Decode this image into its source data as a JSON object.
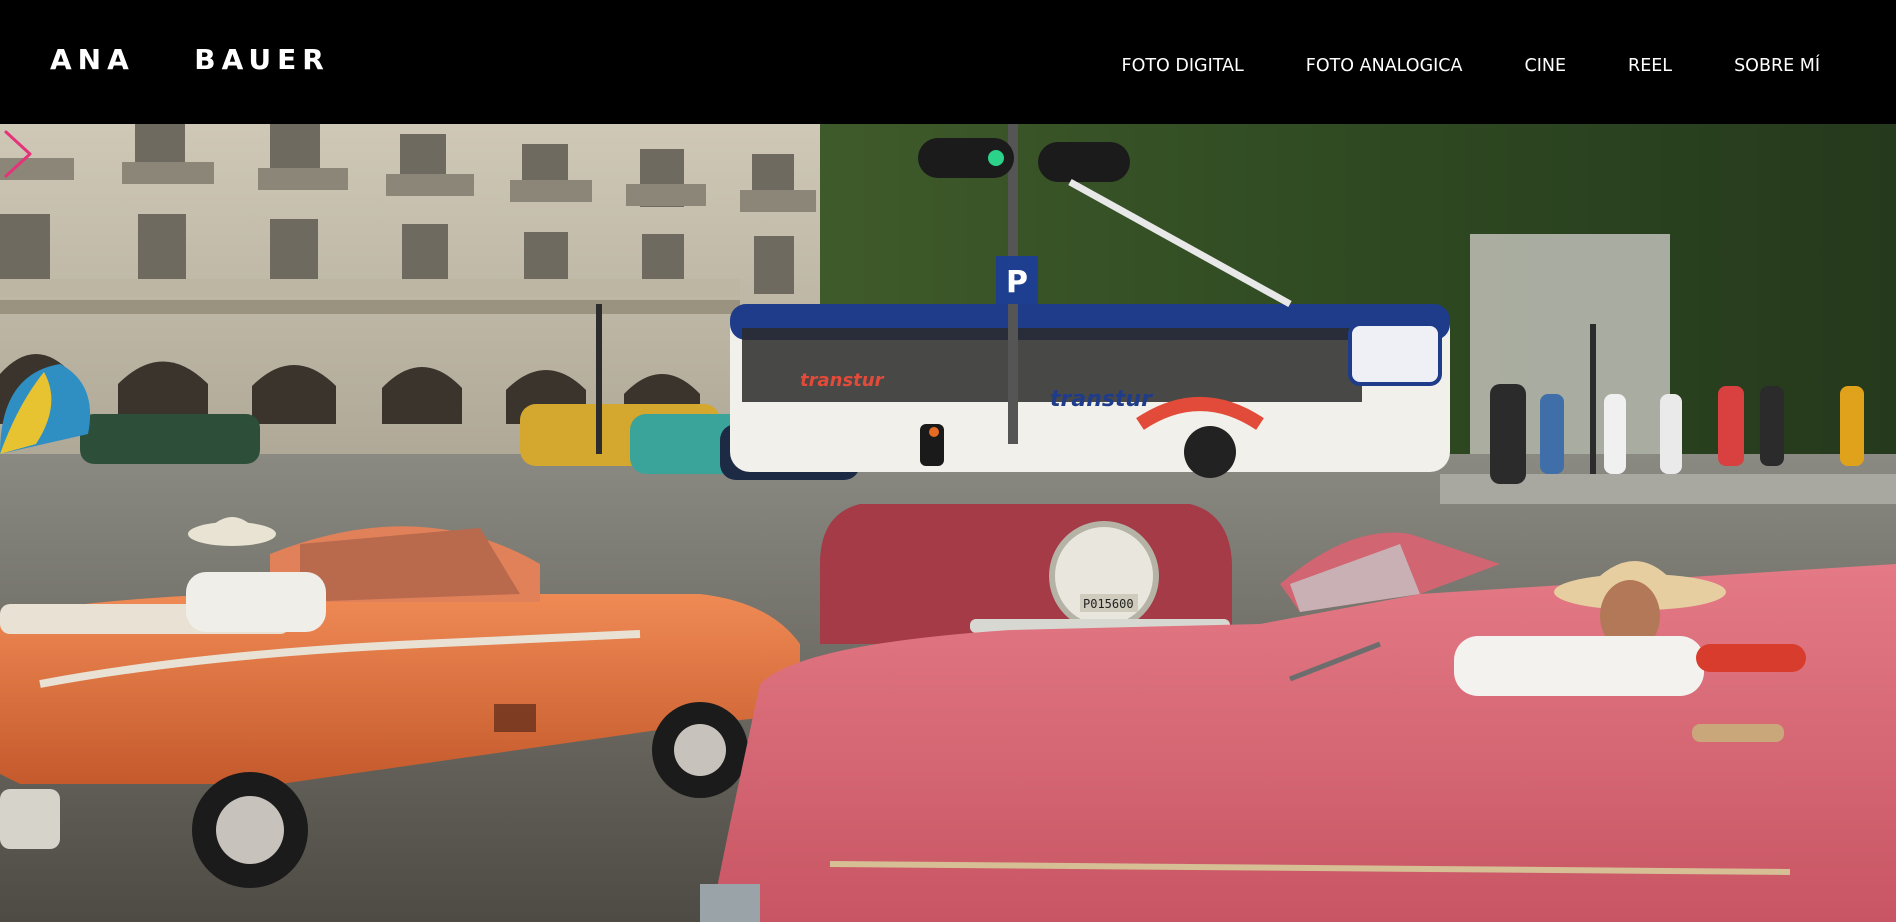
{
  "site": {
    "logo": "ANA  BAUER"
  },
  "nav": {
    "items": [
      {
        "label": "FOTO DIGITAL"
      },
      {
        "label": "FOTO ANALOGICA"
      },
      {
        "label": "CINE"
      },
      {
        "label": "REEL"
      },
      {
        "label": "SOBRE MÍ"
      }
    ]
  },
  "slideshow": {
    "next_icon": "chevron-right-icon",
    "accent_color": "#e5337a",
    "bus_brand": "transtur",
    "parking_sign": "P",
    "license_plate": "P015600"
  },
  "colors": {
    "header_bg": "#000000",
    "nav_text": "#ffffff"
  }
}
